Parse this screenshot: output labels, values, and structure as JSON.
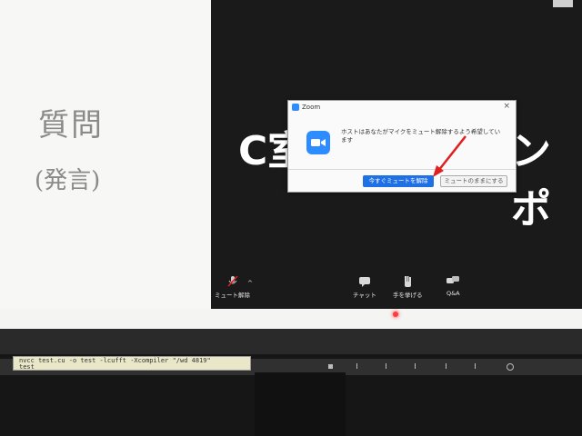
{
  "slide": {
    "left_title": "質問",
    "left_subtitle": "(発言)",
    "background_text_left": "C室",
    "background_text_right": "ンポ"
  },
  "dialog": {
    "app_name": "Zoom",
    "message": "ホストはあなたがマイクをミュート解除するよう希望しています",
    "unmute_now_label": "今すぐミュートを解除",
    "stay_muted_label": "ミュートのままにする",
    "close_glyph": "×"
  },
  "toolbar": {
    "unmute_label": "ミュート解除",
    "chat_label": "チャット",
    "raise_hand_label": "手を挙げる",
    "qa_label": "Q&A"
  },
  "terminal": {
    "line1": "nvcc test.cu -o test -lcufft -Xcompiler \"/wd 4819\"",
    "line2": "test"
  },
  "colors": {
    "zoom_blue": "#2d8cff",
    "button_blue": "#1f6fe5",
    "annotation_red": "#e02020"
  }
}
